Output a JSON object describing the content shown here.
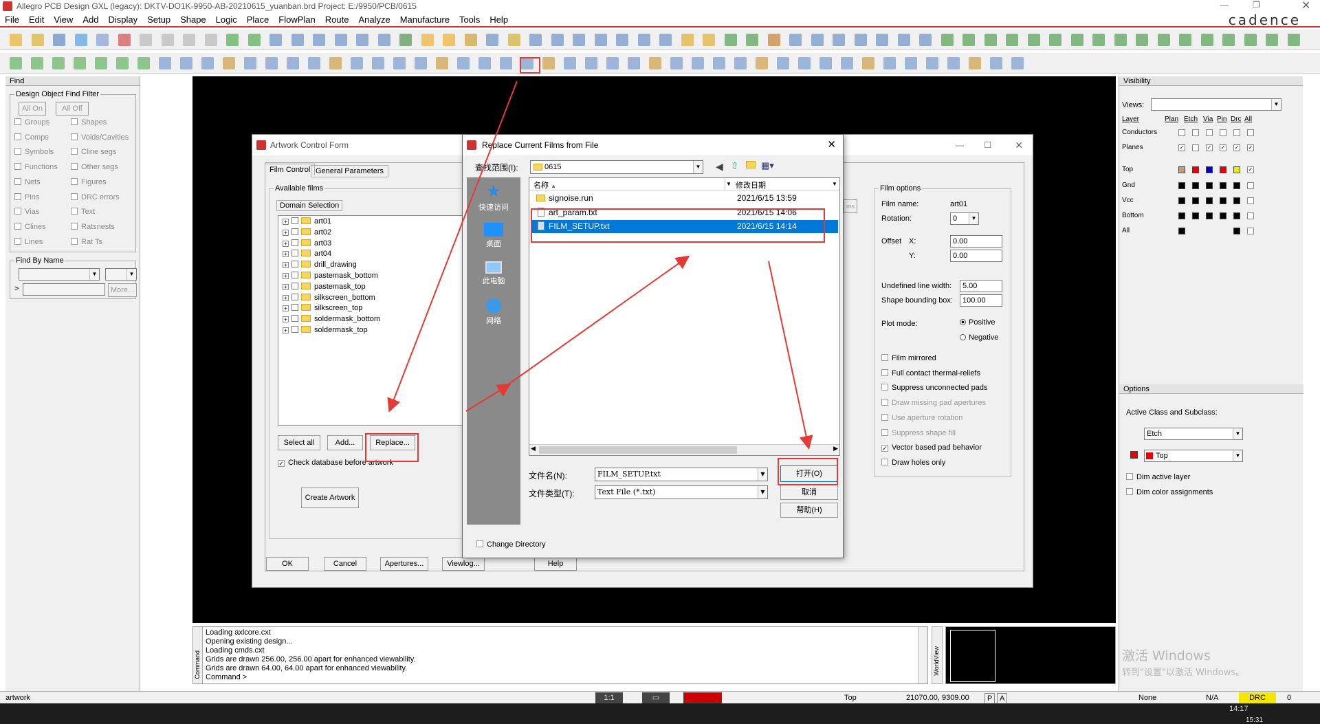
{
  "app": {
    "title": "Allegro PCB Design GXL (legacy): DKTV-DO1K-9950-AB-20210615_yuanban.brd  Project: E:/9950/PCB/0615",
    "brand": "cadence",
    "menus": [
      "File",
      "Edit",
      "View",
      "Add",
      "Display",
      "Setup",
      "Shape",
      "Logic",
      "Place",
      "FlowPlan",
      "Route",
      "Analyze",
      "Manufacture",
      "Tools",
      "Help"
    ]
  },
  "find_panel": {
    "title": "Find",
    "filter_title": "Design Object Find Filter",
    "all_on": "All On",
    "all_off": "All Off",
    "left_items": [
      "Groups",
      "Comps",
      "Symbols",
      "Functions",
      "Nets",
      "Pins",
      "Vias",
      "Clines",
      "Lines"
    ],
    "right_items": [
      "Shapes",
      "Voids/Cavities",
      "Cline segs",
      "Other segs",
      "Figures",
      "DRC errors",
      "Text",
      "Ratsnests",
      "Rat Ts"
    ],
    "find_by_name": "Find By Name",
    "more": "More...",
    "arrow": ">"
  },
  "artwork_form": {
    "title": "Artwork Control Form",
    "tabs": [
      "Film Control",
      "General Parameters"
    ],
    "available_films": "Available films",
    "domain_selection": "Domain Selection",
    "films": [
      "art01",
      "art02",
      "art03",
      "art04",
      "drill_drawing",
      "pastemask_bottom",
      "pastemask_top",
      "silkscreen_bottom",
      "silkscreen_top",
      "soldermask_bottom",
      "soldermask_top"
    ],
    "select_all": "Select all",
    "add": "Add...",
    "replace": "Replace...",
    "check_db": "Check database before artwork",
    "create_artwork": "Create Artwork",
    "ok": "OK",
    "cancel": "Cancel",
    "apertures": "Apertures...",
    "viewlog": "Viewlog...",
    "help": "Help",
    "ms": "ms",
    "film_options": {
      "title": "Film options",
      "film_name_label": "Film name:",
      "film_name": "art01",
      "rotation_label": "Rotation:",
      "rotation": "0",
      "offset_label": "Offset",
      "x_label": "X:",
      "x": "0.00",
      "y_label": "Y:",
      "y": "0.00",
      "undef_label": "Undefined line width:",
      "undef": "5.00",
      "shape_bb_label": "Shape bounding box:",
      "shape_bb": "100.00",
      "plot_mode": "Plot mode:",
      "positive": "Positive",
      "negative": "Negative",
      "checks": [
        {
          "label": "Film mirrored",
          "checked": false,
          "disabled": false
        },
        {
          "label": "Full contact thermal-reliefs",
          "checked": false,
          "disabled": false
        },
        {
          "label": "Suppress unconnected pads",
          "checked": false,
          "disabled": false
        },
        {
          "label": "Draw missing pad apertures",
          "checked": false,
          "disabled": true
        },
        {
          "label": "Use aperture rotation",
          "checked": false,
          "disabled": true
        },
        {
          "label": "Suppress shape fill",
          "checked": false,
          "disabled": true
        },
        {
          "label": "Vector based pad behavior",
          "checked": true,
          "disabled": false
        },
        {
          "label": "Draw holes only",
          "checked": false,
          "disabled": false
        }
      ]
    }
  },
  "replace_dialog": {
    "title": "Replace Current Films from File",
    "lookin_label": "查找范围(I):",
    "lookin": "0615",
    "places": [
      "快速访问",
      "桌面",
      "此电脑",
      "网络"
    ],
    "col_name": "名称",
    "col_date": "修改日期",
    "files": [
      {
        "name": "signoise.run",
        "date": "2021/6/15 13:59",
        "type": "folder",
        "selected": false
      },
      {
        "name": "art_param.txt",
        "date": "2021/6/15 14:06",
        "type": "file",
        "selected": false
      },
      {
        "name": "FILM_SETUP.txt",
        "date": "2021/6/15 14:14",
        "type": "file",
        "selected": true
      }
    ],
    "filename_label": "文件名(N):",
    "filename": "FILM_SETUP.txt",
    "filetype_label": "文件类型(T):",
    "filetype": "Text File (*.txt)",
    "open": "打开(O)",
    "cancel": "取消",
    "help": "帮助(H)",
    "change_dir": "Change Directory"
  },
  "visibility": {
    "title": "Visibility",
    "views_label": "Views:",
    "headers": [
      "Layer",
      "Plan",
      "Etch",
      "Via",
      "Pin",
      "Drc",
      "All"
    ],
    "rows": [
      "Conductors",
      "Planes",
      "Top",
      "Gnd",
      "Vcc",
      "Bottom",
      "All"
    ]
  },
  "options": {
    "title": "Options",
    "active_class_label": "Active Class and Subclass:",
    "class": "Etch",
    "subclass": "Top",
    "dim_active": "Dim active layer",
    "dim_color": "Dim color assignments"
  },
  "console": {
    "lines": [
      "Loading axlcore.cxt",
      "Opening existing design...",
      "Loading cmds.cxt",
      "Grids are drawn 256.00, 256.00 apart for enhanced viewability.",
      "Grids are drawn 64.00, 64.00 apart for enhanced viewability.",
      "Command >"
    ],
    "side_label": "Command",
    "world_label": "WorldView"
  },
  "status": {
    "command": "artwork",
    "layer": "Top",
    "coords": "21070.00, 9309.00",
    "p": "P",
    "a": "A",
    "none": "None",
    "na": "N/A",
    "drc": "DRC",
    "count": "0",
    "zoom": "1:1"
  },
  "watermark": {
    "line1": "激活 Windows",
    "line2": "转到\"设置\"以激活 Windows。"
  },
  "taskbar": {
    "time": "14:17",
    "time2": "15:31"
  },
  "colors": {
    "accent_red": "#e53935",
    "selection_blue": "#0078d7",
    "canvas_black": "#000000",
    "drc_yellow": "#f5e600"
  }
}
